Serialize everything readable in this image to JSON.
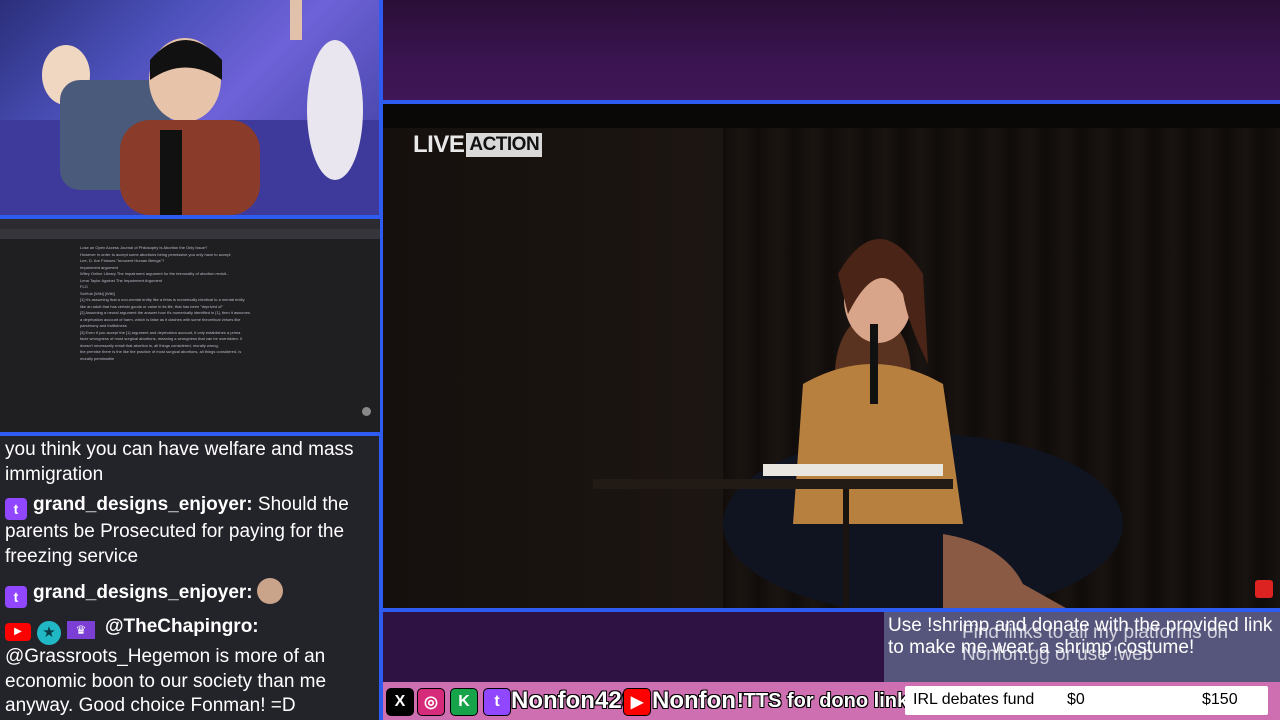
{
  "screen_capture": {
    "doc_lines": [
      "Lose an Open Access Journal of Philosophy Is Abortion the Only Issue?",
      "However in order to accept some abortions being permissive you only have to accept",
      "Lee, D. Are Fetuses \"Innocent Human Beings\"?",
      "Impairment argument",
      "Wiley Online Library The impairment argument for the immorality of abortion revisit...",
      "Lena Taylor Against The Impairment Argument",
      "FLO",
      "SciHub [Wiki] [Wiki]",
      "[1] It's assuming that a non-mental entity like a fetus is numerically identical to a mental entity",
      "like an adult that has certain goods or value in its life, that has been \"deprived of\"",
      "[2] Assuming a neural argument the answer how it's numerically identified in [1], then it assumes",
      "a deprivation account of harm, which is false as it clashes with some theoretical virtues like",
      "parsimony and fruitfulness",
      "[3] Even if you accept the [1] argument and deprivation account, it only establishes a prima",
      "facie wrongness of most surgical abortions, meaning a wrongness that can be overridden. It",
      "doesn't necessarily entail that abortion is, all things considered, morally wrong.",
      "the premise there is the like the practice of most surgical abortions, all things considered, is",
      "morally permissible"
    ]
  },
  "chat": {
    "messages": [
      {
        "text": "you think you can have welfare and mass immigration"
      },
      {
        "badge": "twitch",
        "user": "grand_designs_enjoyer:",
        "text": "Should the parents be Prosecuted for paying for the freezing service"
      },
      {
        "badge": "twitch",
        "user": "grand_designs_enjoyer:",
        "text": ""
      },
      {
        "badge": "youtube",
        "user": "@TheChapingro:",
        "text": "@Grassroots_Hegemon is more of an economic boon to our society than me anyway. Good choice Fonman! =D"
      }
    ]
  },
  "video": {
    "logo_live": "LIVE",
    "logo_action": "ACTION"
  },
  "notice": {
    "line1": "Use !shrimp and donate with the provided link to make me wear a shrimp costume!",
    "line2": "Find links to all my platforms on Nonfon.gg or use !web"
  },
  "ticker": {
    "twitch_handle": "Nonfon420",
    "youtube_handle": "Nonfon",
    "tts_text": "!TTS for dono link",
    "fund_label": "IRL debates fund",
    "fund_current": "$0",
    "fund_goal": "$150"
  },
  "colors": {
    "border_blue": "#2f5cf0",
    "ticker_pink": "#cd6fb0",
    "twitch_purple": "#9146ff",
    "youtube_red": "#ff0000"
  }
}
